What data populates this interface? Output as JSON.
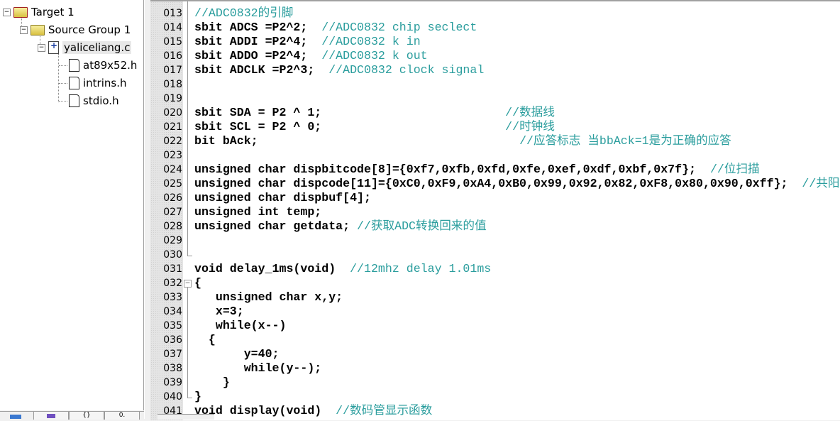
{
  "project_tree": {
    "target": "Target 1",
    "group": "Source Group 1",
    "source_file": "yaliceliang.c",
    "includes": [
      "at89x52.h",
      "intrins.h",
      "stdio.h"
    ]
  },
  "bottom_tabs": [
    {
      "icon": "project-icon",
      "label": ""
    },
    {
      "icon": "books-icon",
      "label": ""
    },
    {
      "icon": "functions-icon",
      "label": "{}"
    },
    {
      "icon": "templates-icon",
      "label": "0."
    }
  ],
  "editor": {
    "lines": [
      {
        "num": "013",
        "text": "//ADC0832的引脚"
      },
      {
        "num": "014",
        "text": "sbit ADCS =P2^2;  //ADC0832 chip seclect"
      },
      {
        "num": "015",
        "text": "sbit ADDI =P2^4;  //ADC0832 k in"
      },
      {
        "num": "016",
        "text": "sbit ADDO =P2^4;  //ADC0832 k out"
      },
      {
        "num": "017",
        "text": "sbit ADCLK =P2^3;  //ADC0832 clock signal"
      },
      {
        "num": "018",
        "text": ""
      },
      {
        "num": "019",
        "text": ""
      },
      {
        "num": "020",
        "text": "sbit SDA = P2 ^ 1;                          //数据线"
      },
      {
        "num": "021",
        "text": "sbit SCL = P2 ^ 0;                          //时钟线"
      },
      {
        "num": "022",
        "text": "bit bAck;                                     //应答标志 当bbAck=1是为正确的应答"
      },
      {
        "num": "023",
        "text": ""
      },
      {
        "num": "024",
        "text": "unsigned char dispbitcode[8]={0xf7,0xfb,0xfd,0xfe,0xef,0xdf,0xbf,0x7f};  //位扫描"
      },
      {
        "num": "025",
        "text": "unsigned char dispcode[11]={0xC0,0xF9,0xA4,0xB0,0x99,0x92,0x82,0xF8,0x80,0x90,0xff};  //共阳"
      },
      {
        "num": "026",
        "text": "unsigned char dispbuf[4];"
      },
      {
        "num": "027",
        "text": "unsigned int temp;"
      },
      {
        "num": "028",
        "text": "unsigned char getdata; //获取ADC转换回来的值"
      },
      {
        "num": "029",
        "text": ""
      },
      {
        "num": "030",
        "text": ""
      },
      {
        "num": "031",
        "text": "void delay_1ms(void)  //12mhz delay 1.01ms"
      },
      {
        "num": "032",
        "text": "{"
      },
      {
        "num": "033",
        "text": "   unsigned char x,y;"
      },
      {
        "num": "034",
        "text": "   x=3;"
      },
      {
        "num": "035",
        "text": "   while(x--)"
      },
      {
        "num": "036",
        "text": "  {"
      },
      {
        "num": "037",
        "text": "       y=40;"
      },
      {
        "num": "038",
        "text": "       while(y--);"
      },
      {
        "num": "039",
        "text": "    }"
      },
      {
        "num": "040",
        "text": "}"
      },
      {
        "num": "041",
        "text": "void display(void)  //数码管显示函数"
      }
    ]
  },
  "colors": {
    "comment": "#2a9d9d",
    "number": "#a020a0",
    "operator": "#1a1a80",
    "keyword": "#000000"
  }
}
